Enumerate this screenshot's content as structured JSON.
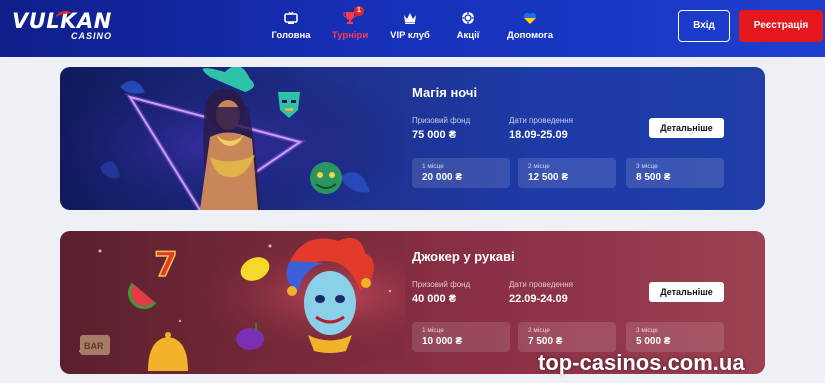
{
  "brand": {
    "name": "VULKAN",
    "sub": "CASINO"
  },
  "nav": [
    {
      "label": "Головна",
      "icon": "tv-icon"
    },
    {
      "label": "Турніри",
      "icon": "trophy-icon",
      "badge": "1",
      "active": true
    },
    {
      "label": "VIP клуб",
      "icon": "crown-icon"
    },
    {
      "label": "Акції",
      "icon": "chip-icon"
    },
    {
      "label": "Допомога",
      "icon": "ukraine-heart-icon"
    }
  ],
  "auth": {
    "login": "Вхід",
    "register": "Реєстрація"
  },
  "tournaments": [
    {
      "title": "Магія ночі",
      "prize_label": "Призовий фонд",
      "prize": "75 000 ₴",
      "dates_label": "Дати проведення",
      "dates": "18.09-25.09",
      "details": "Детальніше",
      "places": [
        {
          "label": "1 місце",
          "value": "20 000 ₴"
        },
        {
          "label": "2 місце",
          "value": "12 500 ₴"
        },
        {
          "label": "3 місце",
          "value": "8 500 ₴"
        }
      ]
    },
    {
      "title": "Джокер у рукаві",
      "prize_label": "Призовий фонд",
      "prize": "40 000 ₴",
      "dates_label": "Дати проведення",
      "dates": "22.09-24.09",
      "details": "Детальніше",
      "places": [
        {
          "label": "1 місце",
          "value": "10 000 ₴"
        },
        {
          "label": "2 місце",
          "value": "7 500 ₴"
        },
        {
          "label": "3 місце",
          "value": "5 000 ₴"
        }
      ]
    }
  ],
  "watermark": "top-casinos.com.ua",
  "colors": {
    "header": "#1630b8",
    "accent": "#e4161e",
    "active_nav": "#ff3a4a"
  }
}
